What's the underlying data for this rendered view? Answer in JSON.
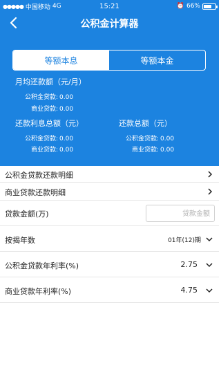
{
  "status_bar": {
    "carrier": "中国移动",
    "network": "4G",
    "time": "15:21",
    "battery": "66%",
    "battery_level": 0.66
  },
  "nav": {
    "title": "公积金计算器"
  },
  "tabs": {
    "tab1": "等额本息",
    "tab2": "等额本金"
  },
  "monthly": {
    "title": "月均还款额（元/月）",
    "gjj_label": "公积金贷款:",
    "gjj_value": "0.00",
    "sy_label": "商业贷款:",
    "sy_value": "0.00"
  },
  "interest_total": {
    "title": "还款利息总额（元）",
    "gjj_label": "公积金贷款:",
    "gjj_value": "0.00",
    "sy_label": "商业贷款:",
    "sy_value": "0.00"
  },
  "repay_total": {
    "title": "还款总额（元）",
    "gjj_label": "公积金贷款:",
    "gjj_value": "0.00",
    "sy_label": "商业贷款:",
    "sy_value": "0.00"
  },
  "rows": {
    "gjj_detail": "公积金贷款还款明细",
    "sy_detail": "商业贷款还款明细",
    "loan_amount_label": "贷款金额(万)",
    "loan_amount_placeholder": "贷款金额",
    "years_label": "按揭年数",
    "years_value": "01年(12)期",
    "gjj_rate_label": "公积金贷款年利率(%)",
    "gjj_rate_value": "2.75",
    "sy_rate_label": "商业贷款年利率(%)",
    "sy_rate_value": "4.75"
  }
}
